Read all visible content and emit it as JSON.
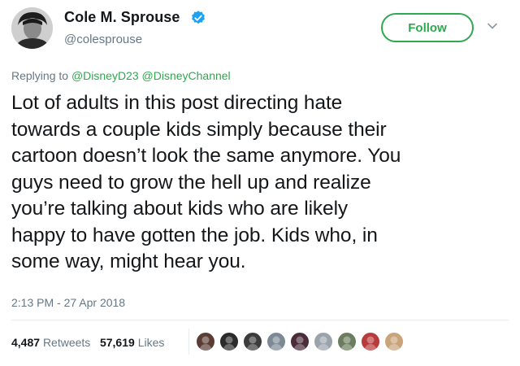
{
  "author": {
    "name": "Cole M. Sprouse",
    "handle": "@colesprouse",
    "verified": true
  },
  "follow_button": {
    "label": "Follow"
  },
  "reply": {
    "prefix": "Replying to ",
    "mentions": [
      "@DisneyD23",
      "@DisneyChannel"
    ]
  },
  "tweet": {
    "lines": [
      "Lot of adults in this post directing hate",
      "towards a couple kids simply because their",
      "cartoon doesn’t look the same anymore. You",
      "guys need to grow the hell up and realize",
      "you’re talking about kids who are likely",
      "happy to have gotten the job. Kids who, in",
      "some way, might hear you."
    ],
    "timestamp": "2:13 PM - 27 Apr 2018"
  },
  "stats": {
    "retweets_count": "4,487",
    "retweets_label": "Retweets",
    "likes_count": "57,619",
    "likes_label": "Likes"
  },
  "likers": [
    {
      "icon": "avatar-icon",
      "color": "#5a3e36"
    },
    {
      "icon": "avatar-icon",
      "color": "#2b2b2b"
    },
    {
      "icon": "avatar-icon",
      "color": "#3c3c3c"
    },
    {
      "icon": "avatar-icon",
      "color": "#7d8a96"
    },
    {
      "icon": "avatar-icon",
      "color": "#4a2c3a"
    },
    {
      "icon": "avatar-icon",
      "color": "#9aa3ab"
    },
    {
      "icon": "avatar-icon",
      "color": "#6b7d5e"
    },
    {
      "icon": "avatar-icon",
      "color": "#b83a3a"
    },
    {
      "icon": "avatar-icon",
      "color": "#c9a37a"
    }
  ],
  "colors": {
    "accent": "#2fa84f",
    "secondary_text": "#657786",
    "verified": "#1da1f2"
  }
}
